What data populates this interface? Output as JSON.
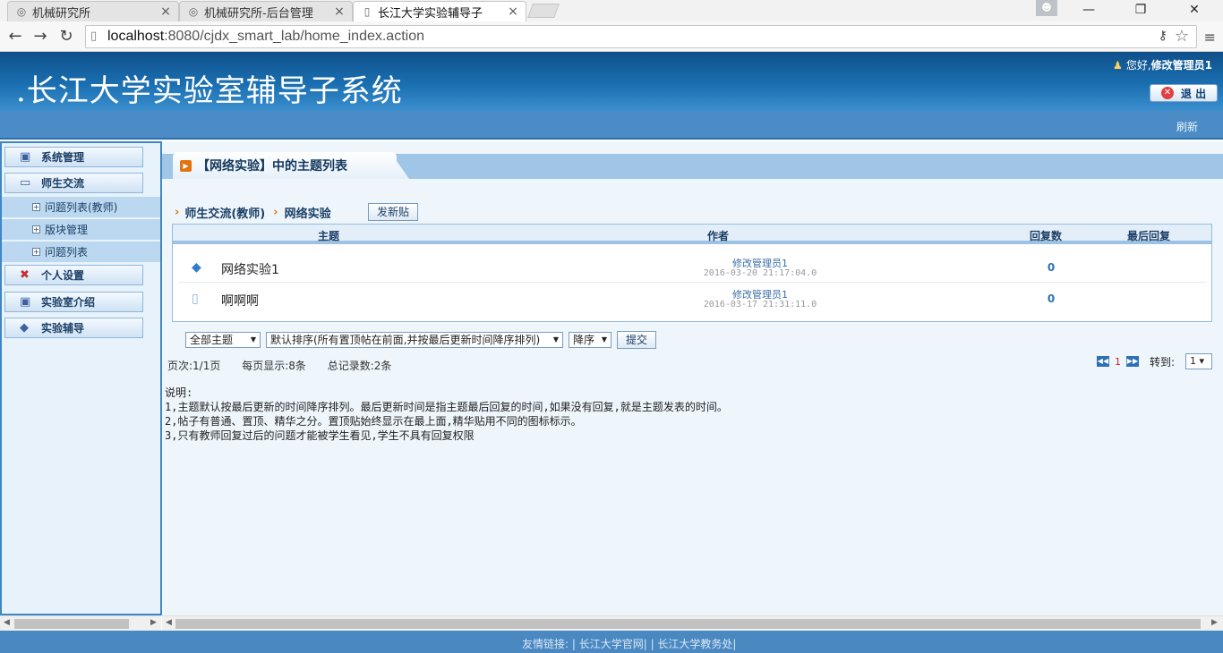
{
  "browser": {
    "tabs": [
      {
        "title": "机械研究所"
      },
      {
        "title": "机械研究所-后台管理"
      },
      {
        "title": "长江大学实验辅导子"
      }
    ],
    "url_host": "localhost",
    "url_path": ":8080/cjdx_smart_lab/home_index.action"
  },
  "header": {
    "title": ".长江大学实验室辅导子系统",
    "greeting": "您好,",
    "username": "修改管理员1",
    "logout_label": "退 出",
    "refresh_label": "刷新"
  },
  "sidebar": {
    "items": [
      {
        "label": "系统管理",
        "icon": "cube-icon"
      },
      {
        "label": "师生交流",
        "icon": "monitor-icon"
      },
      {
        "label": "个人设置",
        "icon": "tools-icon"
      },
      {
        "label": "实验室介绍",
        "icon": "cube-icon"
      },
      {
        "label": "实验辅导",
        "icon": "book-icon"
      }
    ],
    "subitems": [
      {
        "label": "问题列表(教师)"
      },
      {
        "label": "版块管理"
      },
      {
        "label": "问题列表"
      }
    ]
  },
  "main": {
    "tab_title": "【网络实验】中的主题列表",
    "breadcrumb": [
      "师生交流(教师)",
      "网络实验"
    ],
    "new_post_label": "发新贴",
    "columns": [
      "主题",
      "作者",
      "回复数",
      "最后回复"
    ],
    "rows": [
      {
        "icon": "diamond-icon",
        "title": "网络实验1",
        "author": "修改管理员1",
        "time": "2016-03-20 21:17:04.0",
        "replies": "0",
        "last_reply": ""
      },
      {
        "icon": "document-icon",
        "title": "啊啊啊",
        "author": "修改管理员1",
        "time": "2016-03-17 21:31:11.0",
        "replies": "0",
        "last_reply": ""
      }
    ],
    "filter_topic": "全部主题",
    "filter_sort": "默认排序(所有置顶帖在前面,并按最后更新时间降序排列)",
    "filter_order": "降序",
    "submit_label": "提交",
    "page_info": "页次:1/1页",
    "per_page": "每页显示:8条",
    "total": "总记录数:2条",
    "current_page": "1",
    "goto_label": "转到:",
    "goto_value": "1",
    "notes": [
      "说明:",
      "1,主题默认按最后更新的时间降序排列。最后更新时间是指主题最后回复的时间,如果没有回复,就是主题发表的时间。",
      "2,帖子有普通、置顶、精华之分。置顶贴始终显示在最上面,精华贴用不同的图标标示。",
      "3,只有教师回复过后的问题才能被学生看见,学生不具有回复权限"
    ]
  },
  "footer": {
    "text": "友情链接: | 长江大学官网| | 长江大学教务处|"
  }
}
